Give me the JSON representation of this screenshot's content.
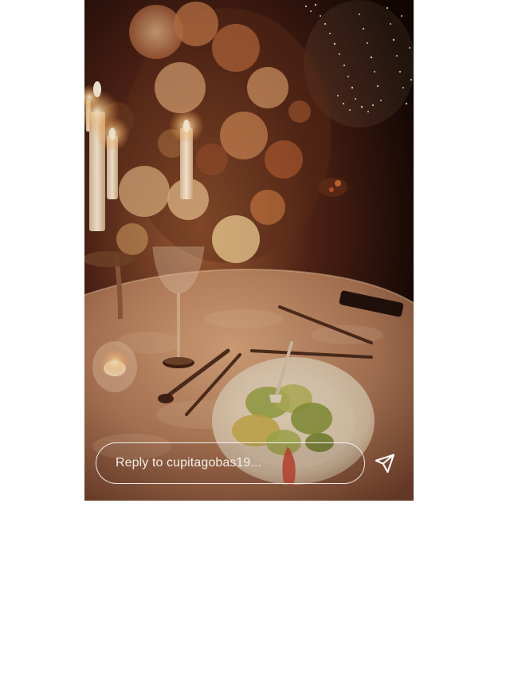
{
  "story": {
    "reply_placeholder": "Reply to cupitagobas19...",
    "send_icon": "paper-plane-icon",
    "scene_description_colors": {
      "background": "#120603",
      "warm_light": "#e6b07a",
      "tablecloth": "#b98a66"
    }
  }
}
